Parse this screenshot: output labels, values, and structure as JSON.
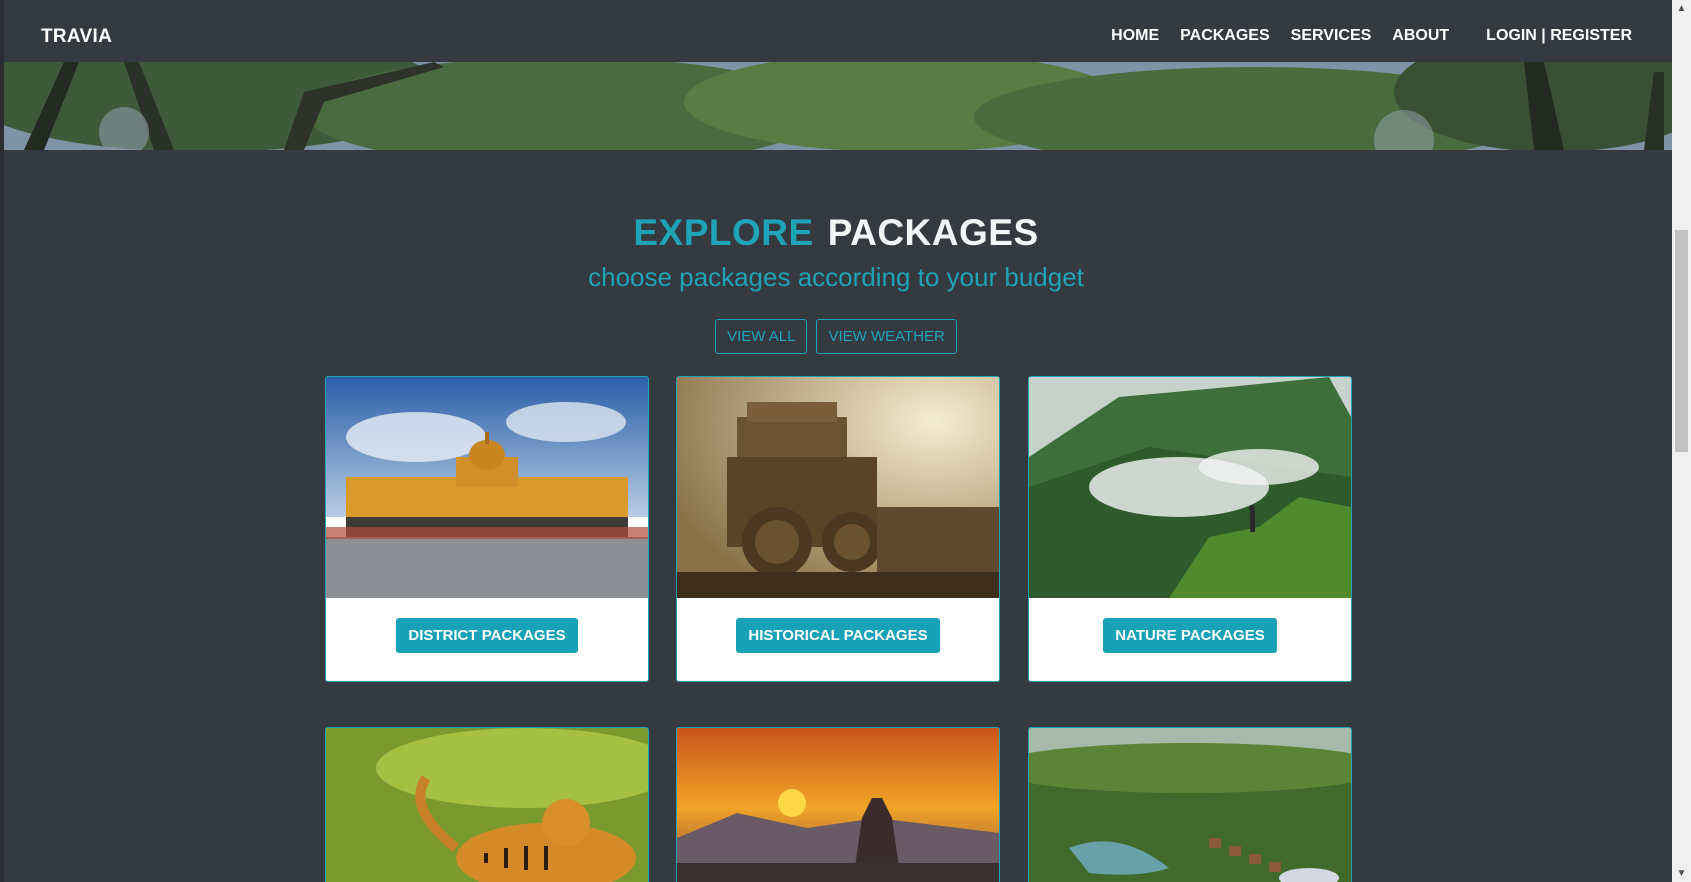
{
  "nav": {
    "brand": "TRAVIA",
    "links": [
      "HOME",
      "PACKAGES",
      "SERVICES",
      "ABOUT"
    ],
    "login": "LOGIN | REGISTER"
  },
  "section": {
    "title_part1": "EXPLORE",
    "title_part2": "PACKAGES",
    "subtitle": "choose packages according to your budget",
    "buttons": [
      "VIEW ALL",
      "VIEW WEATHER"
    ]
  },
  "cards": [
    {
      "label": "DISTRICT PACKAGES",
      "image": "palace-image"
    },
    {
      "label": "HISTORICAL PACKAGES",
      "image": "stone-chariot-image"
    },
    {
      "label": "NATURE PACKAGES",
      "image": "misty-mountain-image"
    }
  ],
  "cards_row2": [
    {
      "image": "tiger-image"
    },
    {
      "image": "sunset-temple-image"
    },
    {
      "image": "jungle-resort-image"
    }
  ],
  "colors": {
    "accent": "#1fa3b6",
    "button": "#17a2b8",
    "background": "#343a40"
  }
}
